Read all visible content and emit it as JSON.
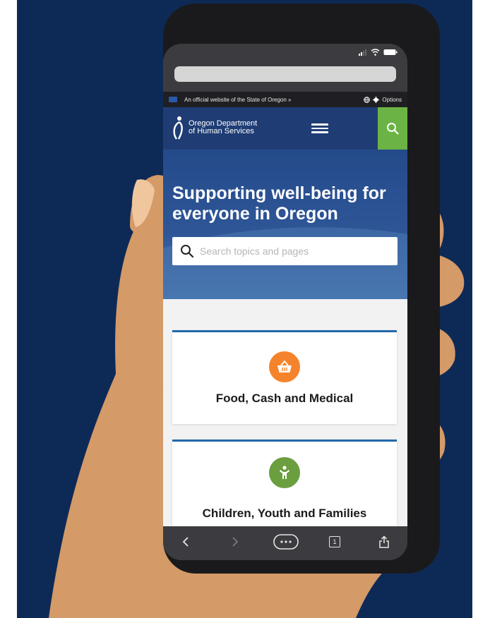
{
  "browser": {
    "status_icons": [
      "signal-icon",
      "wifi-icon",
      "battery-icon"
    ],
    "url": "",
    "bottom_nav": [
      "back-icon",
      "forward-icon",
      "more-icon",
      "tabs-icon",
      "share-icon"
    ],
    "tab_count": "1"
  },
  "official_banner": {
    "text": "An official website of the State of Oregon »",
    "options_label": "Options"
  },
  "header": {
    "logo_line1": "Oregon Department",
    "logo_line2": "of Human Services"
  },
  "hero": {
    "title": "Supporting well-being for everyone in Oregon",
    "search_placeholder": "Search topics and pages"
  },
  "cards": [
    {
      "title": "Food, Cash and Medical",
      "icon": "basket-icon",
      "icon_color": "#f5832b"
    },
    {
      "title": "Children, Youth and Families",
      "icon": "child-icon",
      "icon_color": "#6a9e3f"
    }
  ],
  "colors": {
    "background": "#0d2a57",
    "header_blue": "#1f3d74",
    "search_green": "#6ab344",
    "card_border": "#2169aa",
    "skin": "#d49a68"
  }
}
